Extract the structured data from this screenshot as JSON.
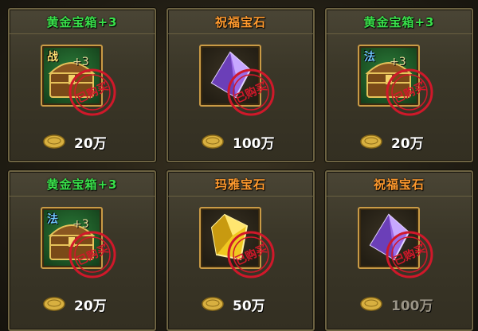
{
  "items": [
    {
      "title": "黄金宝箱+3",
      "title_color": "green",
      "icon": "treasure-chest-icon",
      "class_tag": "战",
      "plus": "+3",
      "stamp": "已购买",
      "price": "20万",
      "slot": "green",
      "item": "chest"
    },
    {
      "title": "祝福宝石",
      "title_color": "orange",
      "icon": "purple-gem-icon",
      "class_tag": "",
      "plus": "",
      "stamp": "已购买",
      "price": "100万",
      "slot": "dark",
      "item": "purple"
    },
    {
      "title": "黄金宝箱+3",
      "title_color": "green",
      "icon": "treasure-chest-icon",
      "class_tag": "法",
      "plus": "+3",
      "stamp": "已购买",
      "price": "20万",
      "slot": "green",
      "item": "chest"
    },
    {
      "title": "黄金宝箱+3",
      "title_color": "green",
      "icon": "treasure-chest-icon",
      "class_tag": "法",
      "plus": "+3",
      "stamp": "已购买",
      "price": "20万",
      "slot": "green",
      "item": "chest"
    },
    {
      "title": "玛雅宝石",
      "title_color": "orange",
      "icon": "yellow-gem-icon",
      "class_tag": "",
      "plus": "",
      "stamp": "已购买",
      "price": "50万",
      "slot": "dark",
      "item": "yellow"
    },
    {
      "title": "祝福宝石",
      "title_color": "orange",
      "icon": "purple-gem-icon",
      "class_tag": "",
      "plus": "",
      "stamp": "已购买",
      "price": "100万",
      "slot": "dark",
      "item": "purple"
    }
  ],
  "colors": {
    "green_title": "#39e04a",
    "orange_title": "#ff9a2e",
    "stamp_red": "#d0182a",
    "coin_gold": "#d8b040"
  }
}
